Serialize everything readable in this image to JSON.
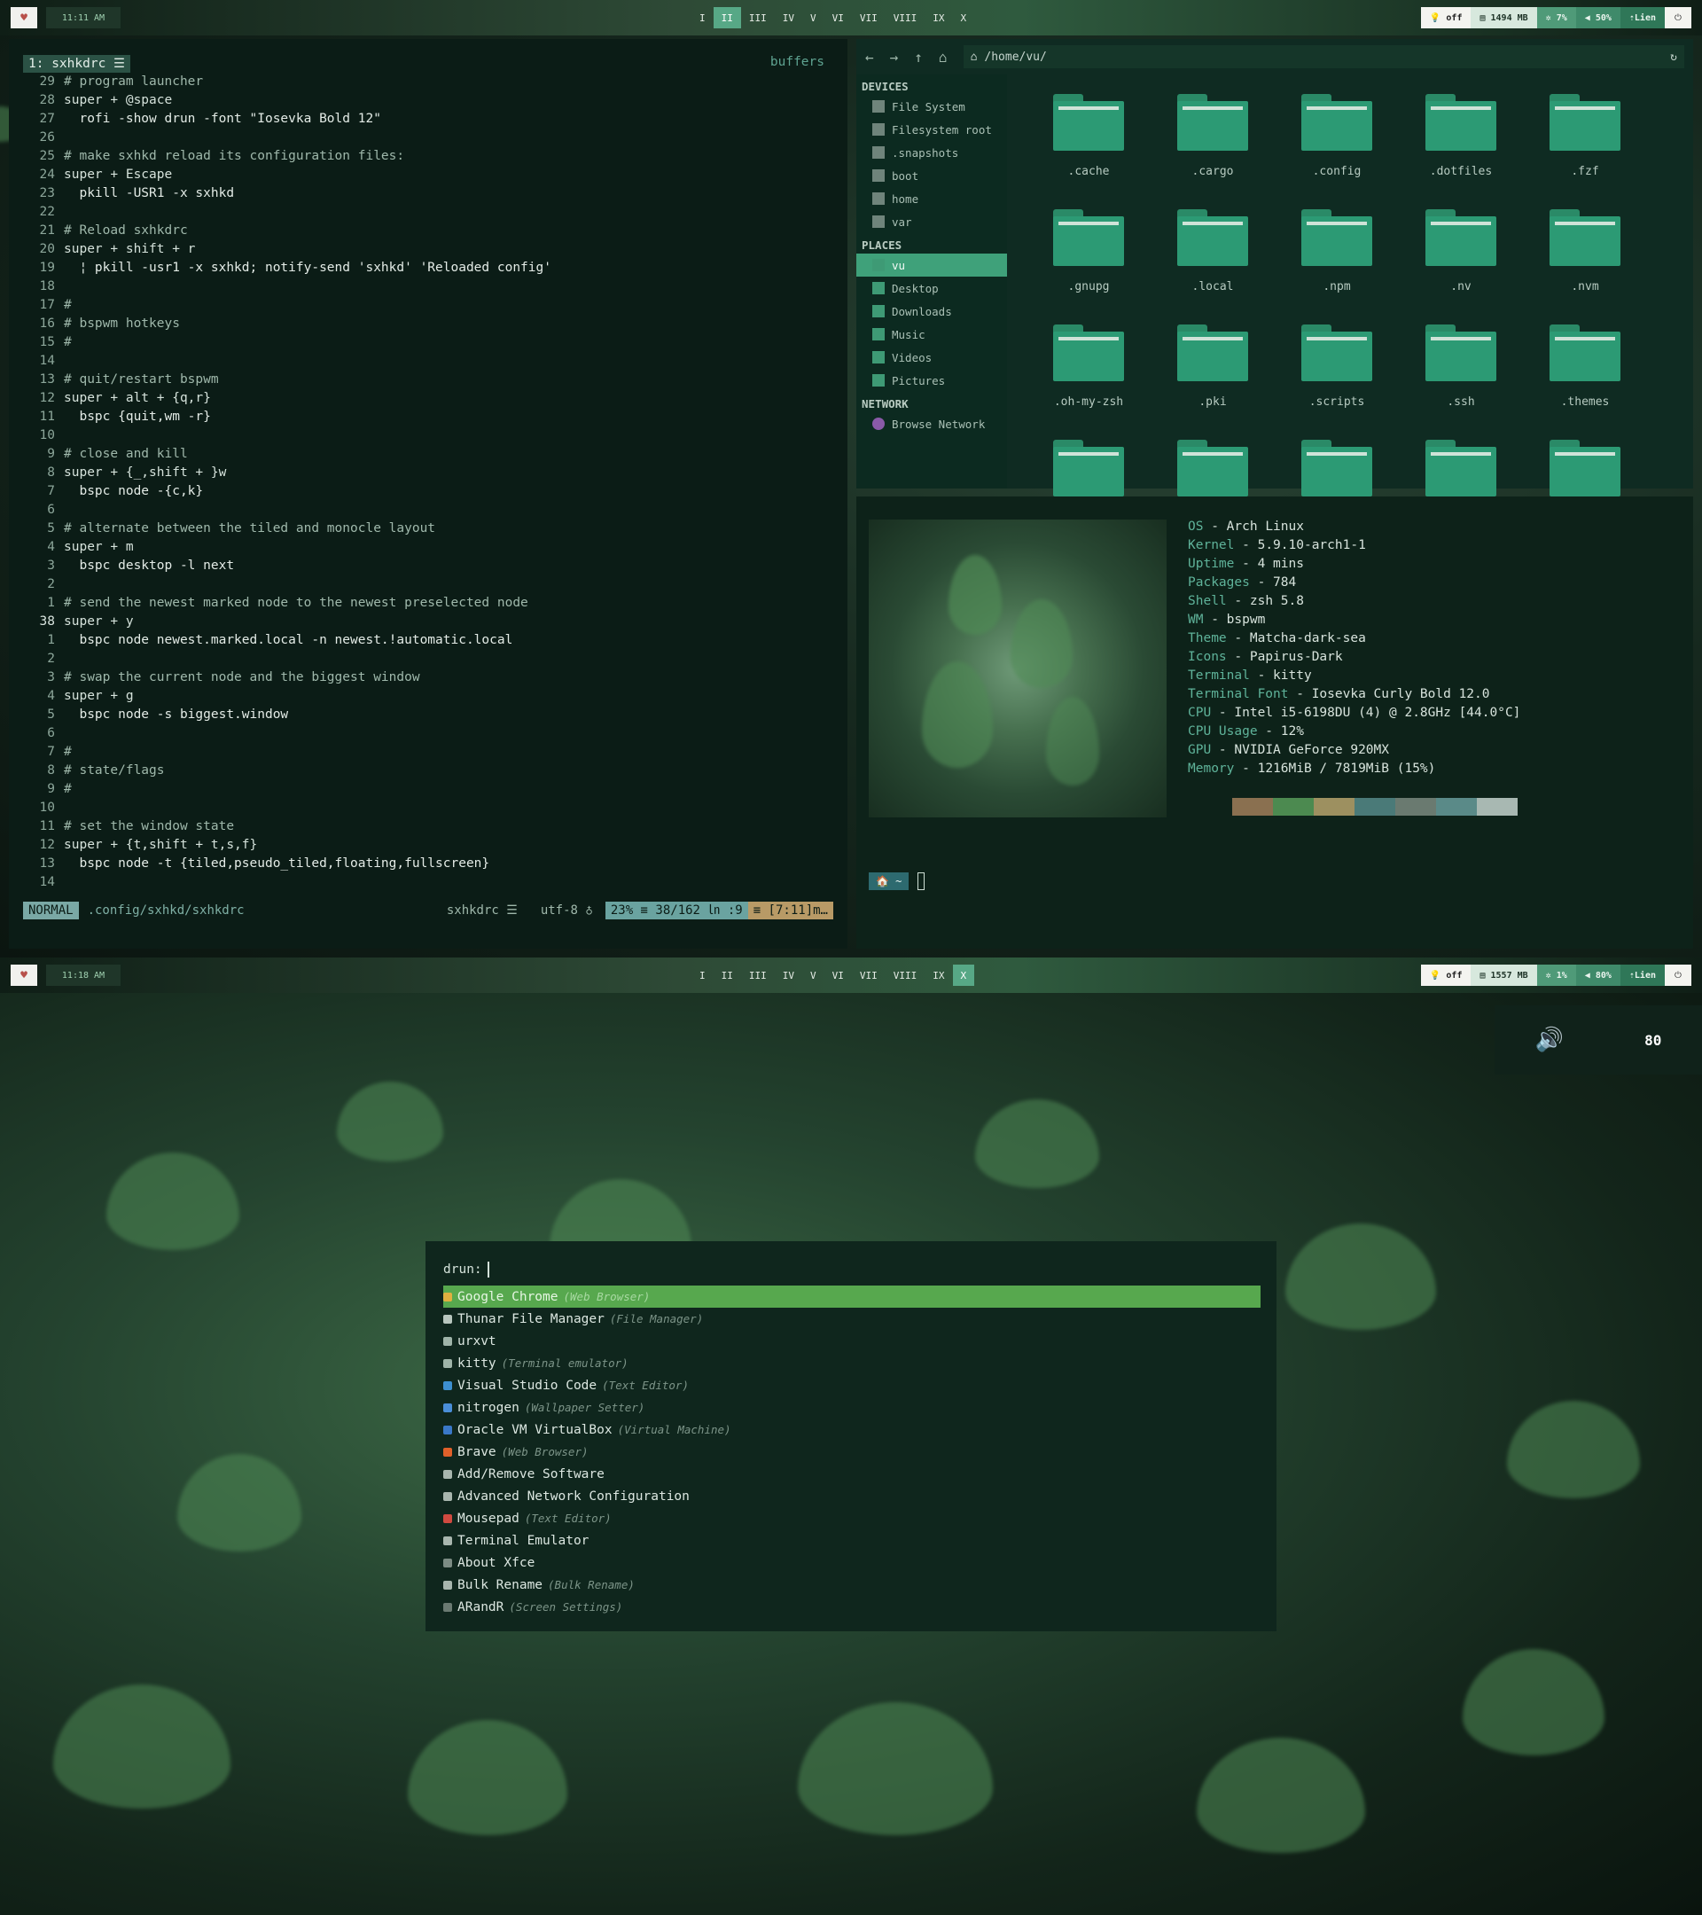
{
  "colors": {
    "accent": "#57a886",
    "rofi_selected": "#57a84e"
  },
  "screen1": {
    "bar": {
      "heart": "♥",
      "clock": "11:11 AM",
      "workspaces": [
        "I",
        "II",
        "III",
        "IV",
        "V",
        "VI",
        "VII",
        "VIII",
        "IX",
        "X"
      ],
      "active_workspace": "II",
      "stats": {
        "dnd": "off",
        "ram": "1494 MB",
        "cpu": "7%",
        "volume": "50%",
        "network": "Lien",
        "power": "⏻"
      }
    },
    "editor": {
      "tab": "1: sxhkdrc ☰",
      "buffers": "buffers",
      "lines": [
        {
          "n": "29",
          "t": "# program launcher",
          "k": "c"
        },
        {
          "n": "28",
          "t": "super + @space",
          "k": "m"
        },
        {
          "n": "27",
          "t": "  rofi -show drun -font \"Iosevka Bold 12\"",
          "k": "k"
        },
        {
          "n": "26",
          "t": "",
          "k": "c"
        },
        {
          "n": "25",
          "t": "# make sxhkd reload its configuration files:",
          "k": "c"
        },
        {
          "n": "24",
          "t": "super + Escape",
          "k": "m"
        },
        {
          "n": "23",
          "t": "  pkill -USR1 -x sxhkd",
          "k": "k"
        },
        {
          "n": "22",
          "t": "",
          "k": "c"
        },
        {
          "n": "21",
          "t": "# Reload sxhkdrc",
          "k": "c"
        },
        {
          "n": "20",
          "t": "super + shift + r",
          "k": "m"
        },
        {
          "n": "19",
          "t": "  ¦ pkill -usr1 -x sxhkd; notify-send 'sxhkd' 'Reloaded config'",
          "k": "k"
        },
        {
          "n": "18",
          "t": "",
          "k": "c"
        },
        {
          "n": "17",
          "t": "#",
          "k": "c"
        },
        {
          "n": "16",
          "t": "# bspwm hotkeys",
          "k": "c"
        },
        {
          "n": "15",
          "t": "#",
          "k": "c"
        },
        {
          "n": "14",
          "t": "",
          "k": "c"
        },
        {
          "n": "13",
          "t": "# quit/restart bspwm",
          "k": "c"
        },
        {
          "n": "12",
          "t": "super + alt + {q,r}",
          "k": "m"
        },
        {
          "n": "11",
          "t": "  bspc {quit,wm -r}",
          "k": "k"
        },
        {
          "n": "10",
          "t": "",
          "k": "c"
        },
        {
          "n": "9",
          "t": "# close and kill",
          "k": "c"
        },
        {
          "n": "8",
          "t": "super + {_,shift + }w",
          "k": "m"
        },
        {
          "n": "7",
          "t": "  bspc node -{c,k}",
          "k": "k"
        },
        {
          "n": "6",
          "t": "",
          "k": "c"
        },
        {
          "n": "5",
          "t": "# alternate between the tiled and monocle layout",
          "k": "c"
        },
        {
          "n": "4",
          "t": "super + m",
          "k": "m"
        },
        {
          "n": "3",
          "t": "  bspc desktop -l next",
          "k": "k"
        },
        {
          "n": "2",
          "t": "",
          "k": "c"
        },
        {
          "n": "1",
          "t": "# send the newest marked node to the newest preselected node",
          "k": "c"
        },
        {
          "n": "38",
          "t": "super + y",
          "k": "m",
          "cur": true
        },
        {
          "n": "1",
          "t": "  bspc node newest.marked.local -n newest.!automatic.local",
          "k": "k"
        },
        {
          "n": "2",
          "t": "",
          "k": "c"
        },
        {
          "n": "3",
          "t": "# swap the current node and the biggest window",
          "k": "c"
        },
        {
          "n": "4",
          "t": "super + g",
          "k": "m"
        },
        {
          "n": "5",
          "t": "  bspc node -s biggest.window",
          "k": "k"
        },
        {
          "n": "6",
          "t": "",
          "k": "c"
        },
        {
          "n": "7",
          "t": "#",
          "k": "c"
        },
        {
          "n": "8",
          "t": "# state/flags",
          "k": "c"
        },
        {
          "n": "9",
          "t": "#",
          "k": "c"
        },
        {
          "n": "10",
          "t": "",
          "k": "c"
        },
        {
          "n": "11",
          "t": "# set the window state",
          "k": "c"
        },
        {
          "n": "12",
          "t": "super + {t,shift + t,s,f}",
          "k": "m"
        },
        {
          "n": "13",
          "t": "  bspc node -t {tiled,pseudo_tiled,floating,fullscreen}",
          "k": "k"
        },
        {
          "n": "14",
          "t": "",
          "k": "c"
        }
      ],
      "status": {
        "mode": "NORMAL",
        "file": ".config/sxhkd/sxhkdrc",
        "ftype": "sxhkdrc ☰",
        "enc": "utf-8 ♁",
        "pos": "23% ≡ 38/162 ㏑ :9",
        "time": "≡ [7:11]m…"
      }
    },
    "filemanager": {
      "path": "/home/vu/",
      "sections": [
        {
          "title": "DEVICES",
          "items": [
            "File System",
            "Filesystem root",
            ".snapshots",
            "boot",
            "home",
            "var"
          ]
        },
        {
          "title": "PLACES",
          "items": [
            "vu",
            "Desktop",
            "Downloads",
            "Music",
            "Videos",
            "Pictures"
          ]
        },
        {
          "title": "NETWORK",
          "items": [
            "Browse Network"
          ]
        }
      ],
      "selected_place": "vu",
      "folders": [
        ".cache",
        ".cargo",
        ".config",
        ".dotfiles",
        ".fzf",
        ".gnupg",
        ".local",
        ".npm",
        ".nv",
        ".nvm",
        ".oh-my-zsh",
        ".pki",
        ".scripts",
        ".ssh",
        ".themes",
        "",
        "",
        "",
        "",
        ""
      ]
    },
    "neofetch": {
      "info": [
        {
          "k": "OS",
          "v": "Arch Linux"
        },
        {
          "k": "Kernel",
          "v": "5.9.10-arch1-1"
        },
        {
          "k": "Uptime",
          "v": "4 mins"
        },
        {
          "k": "Packages",
          "v": "784"
        },
        {
          "k": "Shell",
          "v": "zsh 5.8"
        },
        {
          "k": "WM",
          "v": "bspwm"
        },
        {
          "k": "Theme",
          "v": "Matcha-dark-sea"
        },
        {
          "k": "Icons",
          "v": "Papirus-Dark"
        },
        {
          "k": "Terminal",
          "v": "kitty"
        },
        {
          "k": "Terminal Font",
          "v": "Iosevka Curly Bold 12.0"
        },
        {
          "k": "CPU",
          "v": "Intel i5-6198DU (4) @ 2.8GHz [44.0°C]"
        },
        {
          "k": "CPU Usage",
          "v": "12%"
        },
        {
          "k": "GPU",
          "v": "NVIDIA GeForce 920MX"
        },
        {
          "k": "Memory",
          "v": "1216MiB / 7819MiB (15%)"
        }
      ],
      "palette": [
        "#8a7050",
        "#4c8a50",
        "#9d9060",
        "#4a7a78",
        "#6a7a70",
        "#5a8a88",
        "#a8b8b2"
      ],
      "prompt": "🏠 ~"
    }
  },
  "screen2": {
    "bar": {
      "heart": "♥",
      "clock": "11:18 AM",
      "workspaces": [
        "I",
        "II",
        "III",
        "IV",
        "V",
        "VI",
        "VII",
        "VIII",
        "IX",
        "X"
      ],
      "active_workspace": "X",
      "stats": {
        "dnd": "off",
        "ram": "1557 MB",
        "cpu": "1%",
        "volume": "80%",
        "network": "Lien",
        "power": "⏻"
      }
    },
    "volume_popup": {
      "icon": "🔊",
      "value": "80"
    },
    "rofi": {
      "prompt": "drun:",
      "items": [
        {
          "name": "Google Chrome",
          "desc": "(Web Browser)",
          "sel": true,
          "color": "#e0b040"
        },
        {
          "name": "Thunar File Manager",
          "desc": "(File Manager)",
          "color": "#b8c6be"
        },
        {
          "name": "urxvt",
          "desc": "",
          "color": "#9fb4a9"
        },
        {
          "name": "kitty",
          "desc": "(Terminal emulator)",
          "color": "#9fb4a9"
        },
        {
          "name": "Visual Studio Code",
          "desc": "(Text Editor)",
          "color": "#3d8fd0"
        },
        {
          "name": "nitrogen",
          "desc": "(Wallpaper Setter)",
          "color": "#4a8ed8"
        },
        {
          "name": "Oracle VM VirtualBox",
          "desc": "(Virtual Machine)",
          "color": "#3a78c8"
        },
        {
          "name": "Brave",
          "desc": "(Web Browser)",
          "color": "#e0602a"
        },
        {
          "name": "Add/Remove Software",
          "desc": "",
          "color": "#a8b6ae"
        },
        {
          "name": "Advanced Network Configuration",
          "desc": "",
          "color": "#a8b6ae"
        },
        {
          "name": "Mousepad",
          "desc": "(Text Editor)",
          "color": "#d04a40"
        },
        {
          "name": "Terminal Emulator",
          "desc": "",
          "color": "#a8b6ae"
        },
        {
          "name": "About Xfce",
          "desc": "",
          "color": "#7c8c84"
        },
        {
          "name": "Bulk Rename",
          "desc": "(Bulk Rename)",
          "color": "#a8b6ae"
        },
        {
          "name": "ARandR",
          "desc": "(Screen Settings)",
          "color": "#6a7a72"
        }
      ]
    }
  }
}
